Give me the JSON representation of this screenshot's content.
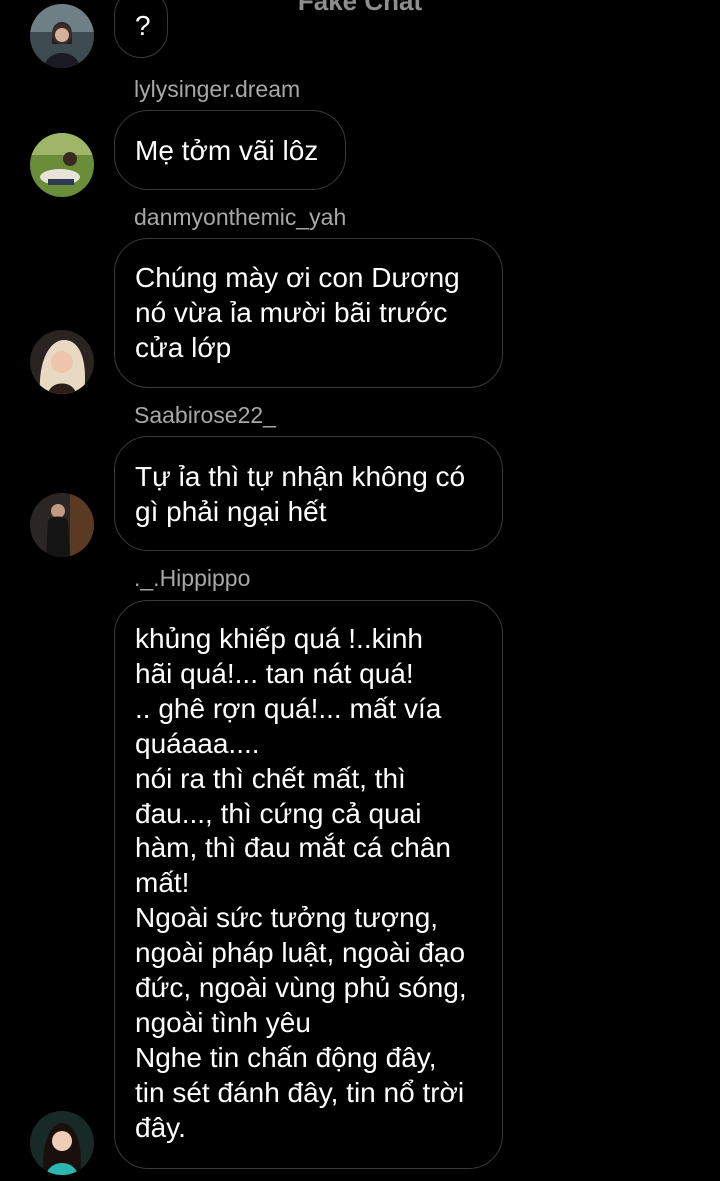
{
  "header": {
    "title": "Fake Chat"
  },
  "messages": [
    {
      "username": "",
      "text": "?",
      "avatar_icon": "user-avatar-icon"
    },
    {
      "username": "lylysinger.dream",
      "text": "Mẹ tởm vãi lôz",
      "avatar_icon": "user-avatar-icon"
    },
    {
      "username": "danmyonthemic_yah",
      "text": "Chúng mày ơi con Dương\nnó vừa ỉa mười bãi trước\ncửa lớp",
      "avatar_icon": "user-avatar-icon"
    },
    {
      "username": "Saabirose22_",
      "text": "Tự ỉa thì tự nhận không có\ngì phải ngại hết",
      "avatar_icon": "user-avatar-icon"
    },
    {
      "username": "._.Hippippo",
      "text": "khủng khiếp quá !..kinh\nhãi quá!... tan nát quá!\n.. ghê rợn quá!... mất vía\nquáaaa....\nnói ra thì chết mất, thì\nđau..., thì cứng cả quai\nhàm, thì đau mắt cá chân\nmất!\nNgoài sức tưởng tượng,\nngoài pháp luật, ngoài đạo\nđức, ngoài vùng phủ sóng,\nngoài tình yêu\nNghe tin chấn động đây,\ntin sét đánh đây, tin nổ trời\nđây.",
      "avatar_icon": "user-avatar-icon"
    }
  ],
  "colors": {
    "background": "#000000",
    "bubble_border": "#3a3a3a",
    "message_text": "#ffffff",
    "username_text": "#a8a8a8"
  }
}
